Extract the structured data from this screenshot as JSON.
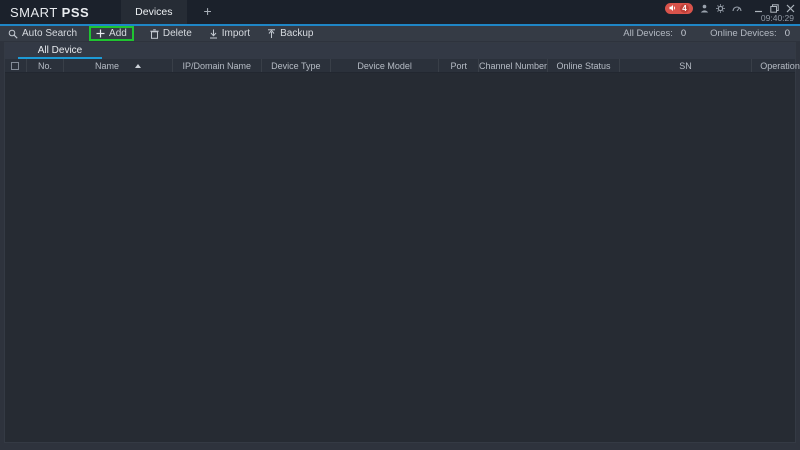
{
  "app": {
    "brand_a": "SMART",
    "brand_b": "PSS",
    "time": "09:40:29",
    "alarm_count": "4"
  },
  "titlebar": {
    "devices_tab": "Devices",
    "new_tab": "+"
  },
  "toolbar": {
    "auto_search": "Auto Search",
    "add": "Add",
    "delete": "Delete",
    "import": "Import",
    "backup": "Backup",
    "all_devices_label": "All Devices:",
    "all_devices_value": "0",
    "online_devices_label": "Online Devices:",
    "online_devices_value": "0"
  },
  "panel": {
    "tab": "All Device",
    "columns": {
      "no": "No.",
      "name": "Name",
      "ip": "IP/Domain Name",
      "type": "Device Type",
      "model": "Device Model",
      "port": "Port",
      "channel": "Channel Number",
      "status": "Online Status",
      "sn": "SN",
      "operation": "Operation"
    },
    "rows": []
  },
  "colors": {
    "accent_blue": "#1f86c6",
    "tab_underline_blue": "#1d9ad6",
    "highlight_green": "#1fc431",
    "alarm_red": "#d9534b",
    "titlebar_bg": "#1b212b",
    "toolbar_bg": "#353b45",
    "panel_bg": "#272c34"
  }
}
